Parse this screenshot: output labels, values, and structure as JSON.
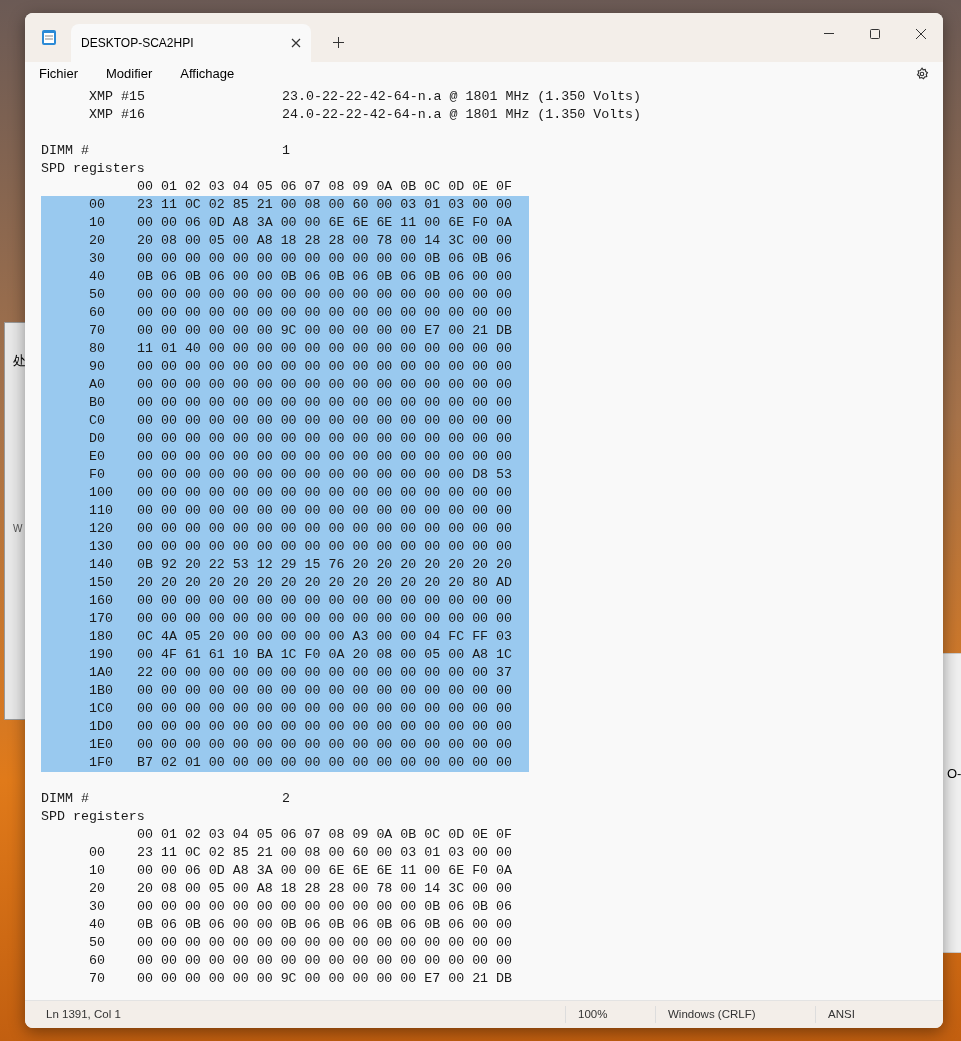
{
  "window": {
    "tab_title": "DESKTOP-SCA2HPI",
    "tab_selected": true
  },
  "menu": [
    "Fichier",
    "Modifier",
    "Affichage"
  ],
  "lines": [
    {
      "kind": "pair",
      "label": "XMP #15",
      "value": "23.0-22-22-42-64-n.a @ 1801 MHz (1.350 Volts)"
    },
    {
      "kind": "pair",
      "label": "XMP #16",
      "value": "24.0-22-22-42-64-n.a @ 1801 MHz (1.350 Volts)"
    },
    {
      "kind": "blank"
    },
    {
      "kind": "dimm",
      "label": "DIMM #",
      "value": "1"
    },
    {
      "kind": "text",
      "text": "SPD registers"
    },
    {
      "kind": "header",
      "text": "00 01 02 03 04 05 06 07 08 09 0A 0B 0C 0D 0E 0F"
    },
    {
      "kind": "row",
      "address": "00",
      "bytes": "23 11 0C 02 85 21 00 08 00 60 00 03 01 03 00 00",
      "selected": true
    },
    {
      "kind": "row",
      "address": "10",
      "bytes": "00 00 06 0D A8 3A 00 00 6E 6E 6E 11 00 6E F0 0A",
      "selected": true
    },
    {
      "kind": "row",
      "address": "20",
      "bytes": "20 08 00 05 00 A8 18 28 28 00 78 00 14 3C 00 00",
      "selected": true
    },
    {
      "kind": "row",
      "address": "30",
      "bytes": "00 00 00 00 00 00 00 00 00 00 00 00 0B 06 0B 06",
      "selected": true
    },
    {
      "kind": "row",
      "address": "40",
      "bytes": "0B 06 0B 06 00 00 0B 06 0B 06 0B 06 0B 06 00 00",
      "selected": true
    },
    {
      "kind": "row",
      "address": "50",
      "bytes": "00 00 00 00 00 00 00 00 00 00 00 00 00 00 00 00",
      "selected": true
    },
    {
      "kind": "row",
      "address": "60",
      "bytes": "00 00 00 00 00 00 00 00 00 00 00 00 00 00 00 00",
      "selected": true
    },
    {
      "kind": "row",
      "address": "70",
      "bytes": "00 00 00 00 00 00 9C 00 00 00 00 00 E7 00 21 DB",
      "selected": true
    },
    {
      "kind": "row",
      "address": "80",
      "bytes": "11 01 40 00 00 00 00 00 00 00 00 00 00 00 00 00",
      "selected": true
    },
    {
      "kind": "row",
      "address": "90",
      "bytes": "00 00 00 00 00 00 00 00 00 00 00 00 00 00 00 00",
      "selected": true
    },
    {
      "kind": "row",
      "address": "A0",
      "bytes": "00 00 00 00 00 00 00 00 00 00 00 00 00 00 00 00",
      "selected": true
    },
    {
      "kind": "row",
      "address": "B0",
      "bytes": "00 00 00 00 00 00 00 00 00 00 00 00 00 00 00 00",
      "selected": true
    },
    {
      "kind": "row",
      "address": "C0",
      "bytes": "00 00 00 00 00 00 00 00 00 00 00 00 00 00 00 00",
      "selected": true
    },
    {
      "kind": "row",
      "address": "D0",
      "bytes": "00 00 00 00 00 00 00 00 00 00 00 00 00 00 00 00",
      "selected": true
    },
    {
      "kind": "row",
      "address": "E0",
      "bytes": "00 00 00 00 00 00 00 00 00 00 00 00 00 00 00 00",
      "selected": true
    },
    {
      "kind": "row",
      "address": "F0",
      "bytes": "00 00 00 00 00 00 00 00 00 00 00 00 00 00 D8 53",
      "selected": true
    },
    {
      "kind": "row",
      "address": "100",
      "bytes": "00 00 00 00 00 00 00 00 00 00 00 00 00 00 00 00",
      "selected": true
    },
    {
      "kind": "row",
      "address": "110",
      "bytes": "00 00 00 00 00 00 00 00 00 00 00 00 00 00 00 00",
      "selected": true
    },
    {
      "kind": "row",
      "address": "120",
      "bytes": "00 00 00 00 00 00 00 00 00 00 00 00 00 00 00 00",
      "selected": true
    },
    {
      "kind": "row",
      "address": "130",
      "bytes": "00 00 00 00 00 00 00 00 00 00 00 00 00 00 00 00",
      "selected": true
    },
    {
      "kind": "row",
      "address": "140",
      "bytes": "0B 92 20 22 53 12 29 15 76 20 20 20 20 20 20 20",
      "selected": true
    },
    {
      "kind": "row",
      "address": "150",
      "bytes": "20 20 20 20 20 20 20 20 20 20 20 20 20 20 80 AD",
      "selected": true
    },
    {
      "kind": "row",
      "address": "160",
      "bytes": "00 00 00 00 00 00 00 00 00 00 00 00 00 00 00 00",
      "selected": true
    },
    {
      "kind": "row",
      "address": "170",
      "bytes": "00 00 00 00 00 00 00 00 00 00 00 00 00 00 00 00",
      "selected": true
    },
    {
      "kind": "row",
      "address": "180",
      "bytes": "0C 4A 05 20 00 00 00 00 00 A3 00 00 04 FC FF 03",
      "selected": true
    },
    {
      "kind": "row",
      "address": "190",
      "bytes": "00 4F 61 61 10 BA 1C F0 0A 20 08 00 05 00 A8 1C",
      "selected": true
    },
    {
      "kind": "row",
      "address": "1A0",
      "bytes": "22 00 00 00 00 00 00 00 00 00 00 00 00 00 00 37",
      "selected": true
    },
    {
      "kind": "row",
      "address": "1B0",
      "bytes": "00 00 00 00 00 00 00 00 00 00 00 00 00 00 00 00",
      "selected": true
    },
    {
      "kind": "row",
      "address": "1C0",
      "bytes": "00 00 00 00 00 00 00 00 00 00 00 00 00 00 00 00",
      "selected": true
    },
    {
      "kind": "row",
      "address": "1D0",
      "bytes": "00 00 00 00 00 00 00 00 00 00 00 00 00 00 00 00",
      "selected": true
    },
    {
      "kind": "row",
      "address": "1E0",
      "bytes": "00 00 00 00 00 00 00 00 00 00 00 00 00 00 00 00",
      "selected": true
    },
    {
      "kind": "row",
      "address": "1F0",
      "bytes": "B7 02 01 00 00 00 00 00 00 00 00 00 00 00 00 00",
      "selected": true
    },
    {
      "kind": "blank"
    },
    {
      "kind": "dimm",
      "label": "DIMM #",
      "value": "2"
    },
    {
      "kind": "text",
      "text": "SPD registers"
    },
    {
      "kind": "header",
      "text": "00 01 02 03 04 05 06 07 08 09 0A 0B 0C 0D 0E 0F"
    },
    {
      "kind": "row",
      "address": "00",
      "bytes": "23 11 0C 02 85 21 00 08 00 60 00 03 01 03 00 00",
      "selected": false
    },
    {
      "kind": "row",
      "address": "10",
      "bytes": "00 00 06 0D A8 3A 00 00 6E 6E 6E 11 00 6E F0 0A",
      "selected": false
    },
    {
      "kind": "row",
      "address": "20",
      "bytes": "20 08 00 05 00 A8 18 28 28 00 78 00 14 3C 00 00",
      "selected": false
    },
    {
      "kind": "row",
      "address": "30",
      "bytes": "00 00 00 00 00 00 00 00 00 00 00 00 0B 06 0B 06",
      "selected": false
    },
    {
      "kind": "row",
      "address": "40",
      "bytes": "0B 06 0B 06 00 00 0B 06 0B 06 0B 06 0B 06 00 00",
      "selected": false
    },
    {
      "kind": "row",
      "address": "50",
      "bytes": "00 00 00 00 00 00 00 00 00 00 00 00 00 00 00 00",
      "selected": false
    },
    {
      "kind": "row",
      "address": "60",
      "bytes": "00 00 00 00 00 00 00 00 00 00 00 00 00 00 00 00",
      "selected": false
    },
    {
      "kind": "row",
      "address": "70",
      "bytes": "00 00 00 00 00 00 9C 00 00 00 00 00 E7 00 21 DB",
      "selected": false
    }
  ],
  "status_bar": {
    "position": "Ln 1391, Col 1",
    "zoom": "100%",
    "line_ending": "Windows (CRLF)",
    "encoding": "ANSI"
  },
  "background": {
    "left_window_text": "处",
    "left_window_label": "W",
    "right_window_text": "O-"
  }
}
